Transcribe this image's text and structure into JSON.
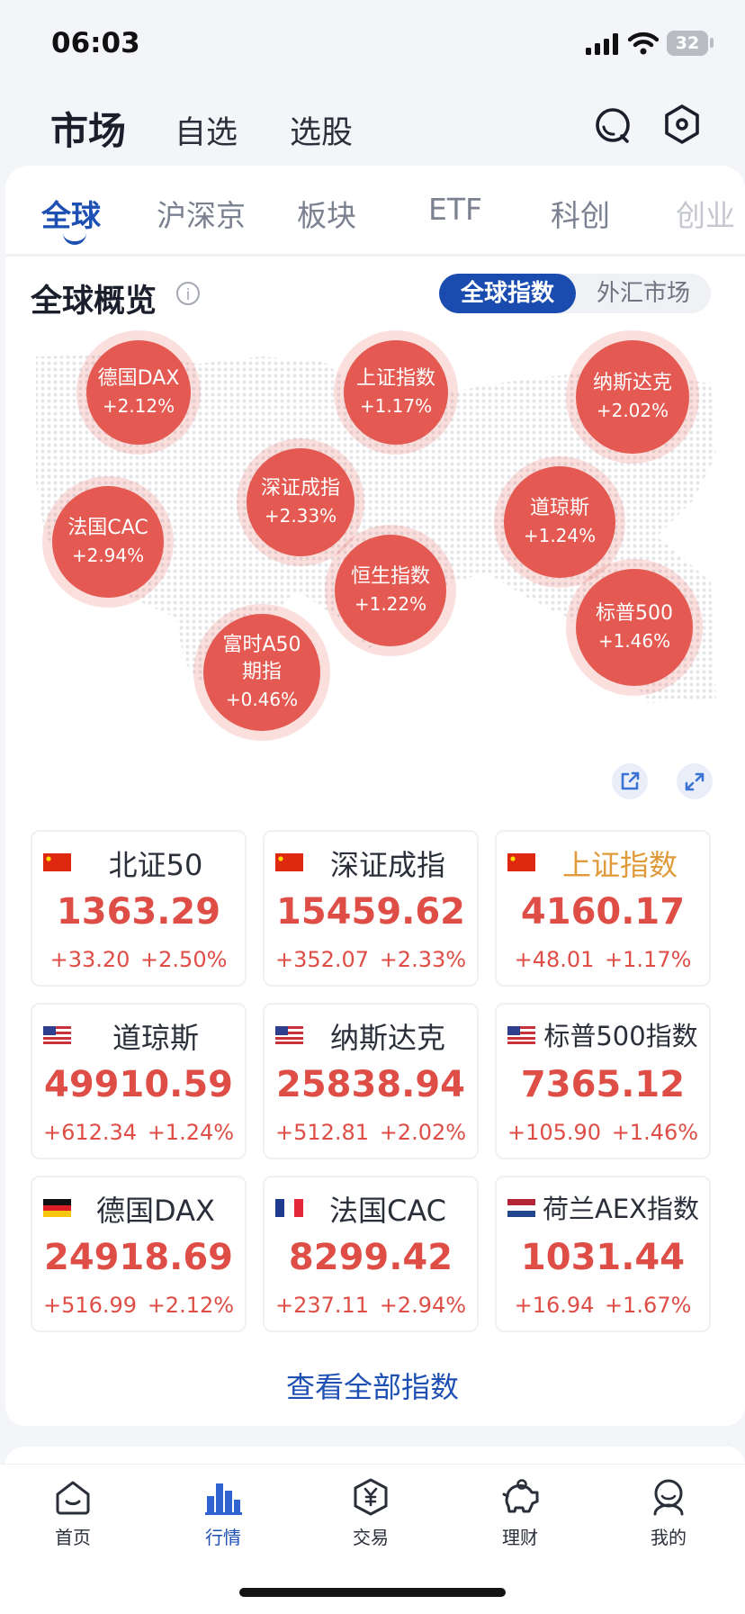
{
  "status_bar": {
    "time": "06:03",
    "battery": "32"
  },
  "header": {
    "title": "市场",
    "tabs": [
      "自选",
      "选股"
    ]
  },
  "sub_tabs": [
    "全球",
    "沪深京",
    "板块",
    "ETF",
    "科创",
    "创业"
  ],
  "overview": {
    "title": "全球概览",
    "info_glyph": "i",
    "segment": {
      "active": "全球指数",
      "inactive": "外汇市场"
    },
    "bubbles": [
      {
        "name": "德国DAX",
        "change": "+2.12%"
      },
      {
        "name": "上证指数",
        "change": "+1.17%"
      },
      {
        "name": "纳斯达克",
        "change": "+2.02%"
      },
      {
        "name": "深证成指",
        "change": "+2.33%"
      },
      {
        "name": "道琼斯",
        "change": "+1.24%"
      },
      {
        "name": "法国CAC",
        "change": "+2.94%"
      },
      {
        "name": "恒生指数",
        "change": "+1.22%"
      },
      {
        "name": "标普500",
        "change": "+1.46%"
      },
      {
        "name": "富时A50",
        "name2": "期指",
        "change": "+0.46%"
      }
    ]
  },
  "indices": [
    {
      "flag": "cn-flag-icon",
      "name": "北证50",
      "value": "1363.29",
      "change": "+33.20",
      "pct": "+2.50%"
    },
    {
      "flag": "cn-flag-icon",
      "name": "深证成指",
      "value": "15459.62",
      "change": "+352.07",
      "pct": "+2.33%"
    },
    {
      "flag": "cn-flag-icon",
      "name": "上证指数",
      "value": "4160.17",
      "change": "+48.01",
      "pct": "+1.17%"
    },
    {
      "flag": "us-flag-icon",
      "name": "道琼斯",
      "value": "49910.59",
      "change": "+612.34",
      "pct": "+1.24%"
    },
    {
      "flag": "us-flag-icon",
      "name": "纳斯达克",
      "value": "25838.94",
      "change": "+512.81",
      "pct": "+2.02%"
    },
    {
      "flag": "us-flag-icon",
      "name": "标普500指数",
      "value": "7365.12",
      "change": "+105.90",
      "pct": "+1.46%"
    },
    {
      "flag": "de-flag-icon",
      "name": "德国DAX",
      "value": "24918.69",
      "change": "+516.99",
      "pct": "+2.12%"
    },
    {
      "flag": "fr-flag-icon",
      "name": "法国CAC",
      "value": "8299.42",
      "change": "+237.11",
      "pct": "+2.94%"
    },
    {
      "flag": "nl-flag-icon",
      "name": "荷兰AEX指数",
      "value": "1031.44",
      "change": "+16.94",
      "pct": "+1.67%"
    }
  ],
  "view_all": "查看全部指数",
  "bottom_nav": [
    "首页",
    "行情",
    "交易",
    "理财",
    "我的"
  ],
  "colors": {
    "accent": "#1e50b4",
    "up": "#de4d46",
    "bubble": "#e45a52",
    "highlight": "#e09a3a"
  }
}
